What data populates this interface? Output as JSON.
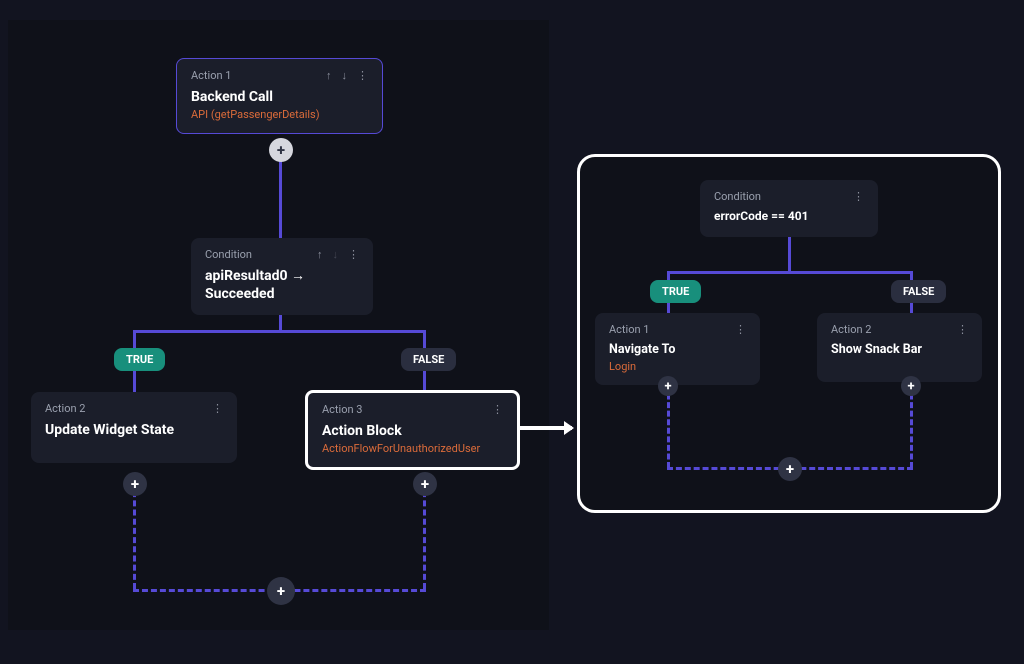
{
  "left": {
    "action1": {
      "label": "Action 1",
      "title": "Backend Call",
      "sub": "API (getPassengerDetails)"
    },
    "condition": {
      "label": "Condition",
      "title": "apiResultad0 → Succeeded"
    },
    "pill_true": "TRUE",
    "pill_false": "FALSE",
    "action2": {
      "label": "Action 2",
      "title": "Update Widget State"
    },
    "action3": {
      "label": "Action 3",
      "title": "Action Block",
      "sub": "ActionFlowForUnauthorizedUser"
    }
  },
  "right": {
    "condition": {
      "label": "Condition",
      "title": "errorCode == 401"
    },
    "pill_true": "TRUE",
    "pill_false": "FALSE",
    "action1": {
      "label": "Action 1",
      "title": "Navigate To",
      "sub": "Login"
    },
    "action2": {
      "label": "Action 2",
      "title": "Show Snack Bar"
    }
  },
  "glyph": {
    "up": "↑",
    "down": "↓",
    "dots": "⋮",
    "plus": "✕"
  }
}
